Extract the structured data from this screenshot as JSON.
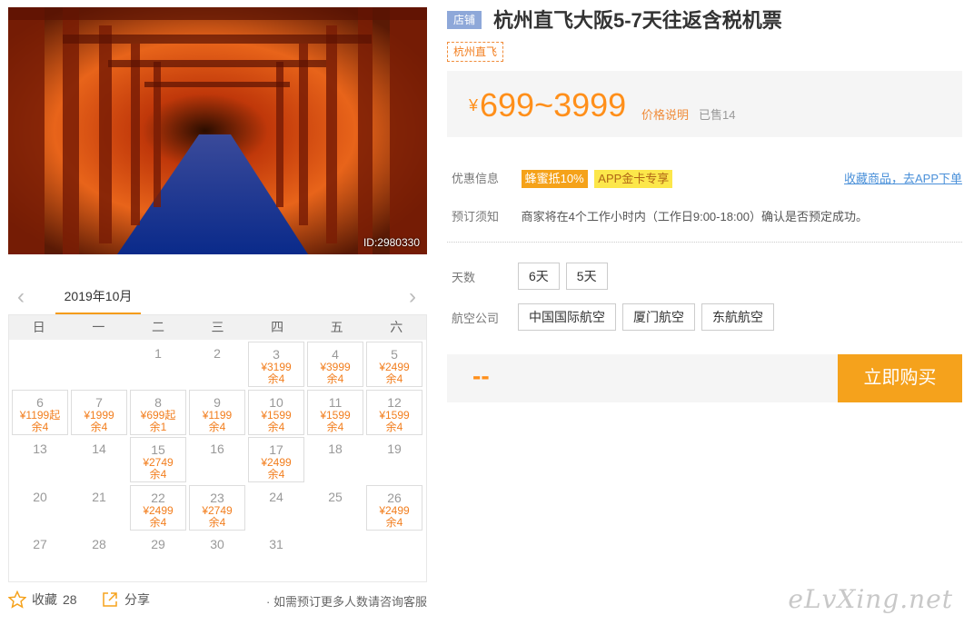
{
  "photo": {
    "id_label": "ID:2980330"
  },
  "calendar": {
    "month": "2019年10月",
    "weekdays": [
      "日",
      "一",
      "二",
      "三",
      "四",
      "五",
      "六"
    ],
    "days": [
      {
        "d": "",
        "p": "",
        "l": ""
      },
      {
        "d": "",
        "p": "",
        "l": ""
      },
      {
        "d": "1",
        "p": "",
        "l": ""
      },
      {
        "d": "2",
        "p": "",
        "l": ""
      },
      {
        "d": "3",
        "p": "¥3199",
        "l": "余4"
      },
      {
        "d": "4",
        "p": "¥3999",
        "l": "余4"
      },
      {
        "d": "5",
        "p": "¥2499",
        "l": "余4"
      },
      {
        "d": "6",
        "p": "¥1199起",
        "l": "余4"
      },
      {
        "d": "7",
        "p": "¥1999",
        "l": "余4"
      },
      {
        "d": "8",
        "p": "¥699起",
        "l": "余1"
      },
      {
        "d": "9",
        "p": "¥1199",
        "l": "余4"
      },
      {
        "d": "10",
        "p": "¥1599",
        "l": "余4"
      },
      {
        "d": "11",
        "p": "¥1599",
        "l": "余4"
      },
      {
        "d": "12",
        "p": "¥1599",
        "l": "余4"
      },
      {
        "d": "13",
        "p": "",
        "l": ""
      },
      {
        "d": "14",
        "p": "",
        "l": ""
      },
      {
        "d": "15",
        "p": "¥2749",
        "l": "余4"
      },
      {
        "d": "16",
        "p": "",
        "l": ""
      },
      {
        "d": "17",
        "p": "¥2499",
        "l": "余4"
      },
      {
        "d": "18",
        "p": "",
        "l": ""
      },
      {
        "d": "19",
        "p": "",
        "l": ""
      },
      {
        "d": "20",
        "p": "",
        "l": ""
      },
      {
        "d": "21",
        "p": "",
        "l": ""
      },
      {
        "d": "22",
        "p": "¥2499",
        "l": "余4"
      },
      {
        "d": "23",
        "p": "¥2749",
        "l": "余4"
      },
      {
        "d": "24",
        "p": "",
        "l": ""
      },
      {
        "d": "25",
        "p": "",
        "l": ""
      },
      {
        "d": "26",
        "p": "¥2499",
        "l": "余4"
      },
      {
        "d": "27",
        "p": "",
        "l": ""
      },
      {
        "d": "28",
        "p": "",
        "l": ""
      },
      {
        "d": "29",
        "p": "",
        "l": ""
      },
      {
        "d": "30",
        "p": "",
        "l": ""
      },
      {
        "d": "31",
        "p": "",
        "l": ""
      }
    ]
  },
  "bottom": {
    "fav_label": "收藏",
    "fav_count": "28",
    "share_label": "分享",
    "tip": "· 如需预订更多人数请咨询客服"
  },
  "product": {
    "shop_tag": "店铺",
    "title": "杭州直飞大阪5-7天往返含税机票",
    "store_tag": "杭州直飞",
    "price_yen": "¥",
    "price_range": "699~3999",
    "price_note": "价格说明",
    "sold": "已售14"
  },
  "promo": {
    "label": "优惠信息",
    "badge1": "蜂蜜抵10%",
    "badge2": "APP金卡专享",
    "fav_link": "收藏商品，去APP下单"
  },
  "notice": {
    "label": "预订须知",
    "text": "商家将在4个工作小时内（工作日9:00-18:00）确认是否预定成功。"
  },
  "days_opt": {
    "label": "天数",
    "options": [
      "6天",
      "5天"
    ]
  },
  "airline": {
    "label": "航空公司",
    "options": [
      "中国国际航空",
      "厦门航空",
      "东航航空"
    ]
  },
  "buy": {
    "price": "--",
    "button": "立即购买"
  },
  "watermark": "eLvXing.net",
  "colors": {
    "accent": "#f5a21c",
    "price": "#ff8f1a",
    "link": "#4a90d9"
  }
}
